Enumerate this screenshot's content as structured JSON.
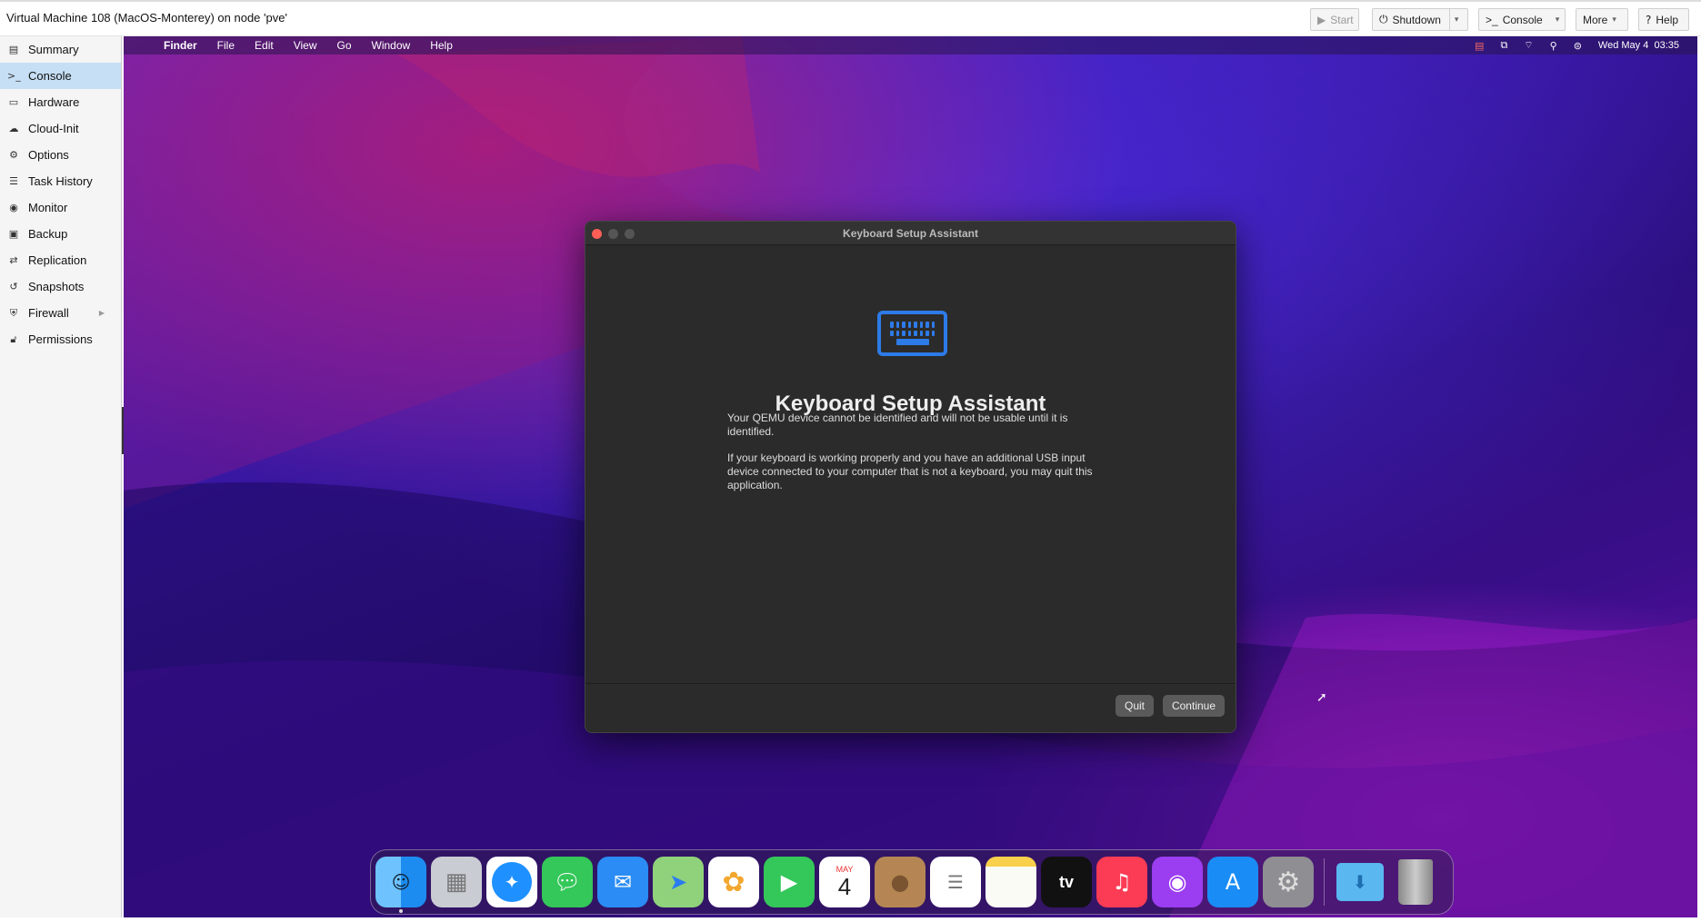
{
  "window_title": "Virtual Machine 108 (MacOS-Monterey) on node 'pve'",
  "toolbar": {
    "start": "Start",
    "shutdown": "Shutdown",
    "console": "Console",
    "more": "More",
    "help": "Help"
  },
  "sidebar": {
    "items": [
      {
        "label": "Summary",
        "icon": "summary-icon"
      },
      {
        "label": "Console",
        "icon": "terminal-icon"
      },
      {
        "label": "Hardware",
        "icon": "monitor-icon"
      },
      {
        "label": "Cloud-Init",
        "icon": "cloud-icon"
      },
      {
        "label": "Options",
        "icon": "gear-icon"
      },
      {
        "label": "Task History",
        "icon": "list-icon"
      },
      {
        "label": "Monitor",
        "icon": "eye-icon"
      },
      {
        "label": "Backup",
        "icon": "floppy-icon"
      },
      {
        "label": "Replication",
        "icon": "retweet-icon"
      },
      {
        "label": "Snapshots",
        "icon": "history-icon"
      },
      {
        "label": "Firewall",
        "icon": "shield-icon"
      },
      {
        "label": "Permissions",
        "icon": "unlock-icon"
      }
    ],
    "active": "Console"
  },
  "mac": {
    "menubar": {
      "app": "Finder",
      "items": [
        "File",
        "Edit",
        "View",
        "Go",
        "Window",
        "Help"
      ],
      "clock": "Wed May 4  03:35"
    },
    "dialog": {
      "window_title": "Keyboard Setup Assistant",
      "heading": "Keyboard Setup Assistant",
      "para1": "Your QEMU device cannot be identified and will not be usable until it is identified.",
      "para2": "If your keyboard is working properly and you have an additional USB input device connected to your computer that is not a keyboard, you may quit this application.",
      "quit": "Quit",
      "continue": "Continue"
    },
    "dock": {
      "calendar_month": "MAY",
      "calendar_day": "4",
      "tv_label": "tv"
    }
  }
}
